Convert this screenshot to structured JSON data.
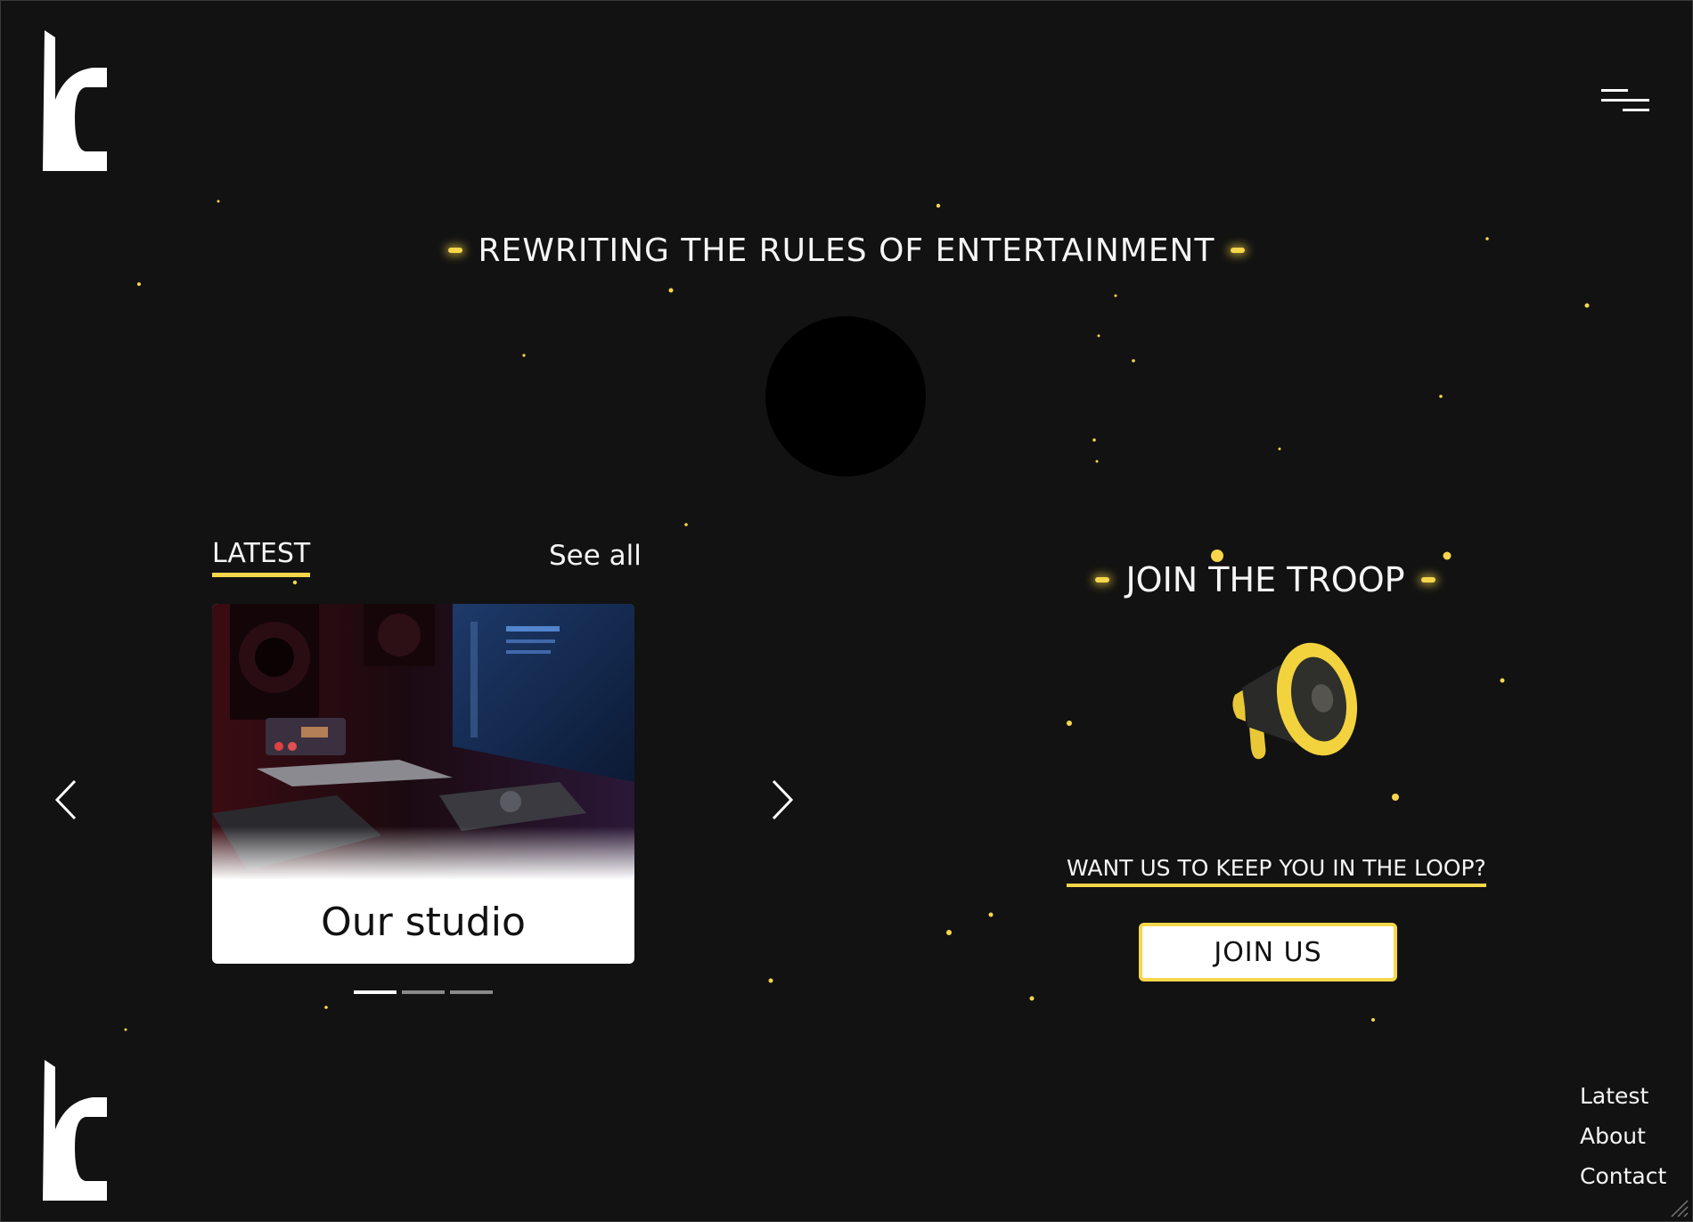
{
  "hero": {
    "title": "REWRITING THE RULES OF ENTERTAINMENT"
  },
  "latest": {
    "tab_label": "LATEST",
    "see_all_label": "See all",
    "cards": [
      {
        "title": "Our studio"
      }
    ],
    "pager": {
      "count": 3,
      "active_index": 0
    }
  },
  "troop": {
    "title": "JOIN THE TROOP",
    "prompt": "WANT US TO KEEP YOU IN THE LOOP?",
    "button_label": "JOIN US"
  },
  "footer": {
    "nav": [
      "Latest",
      "About",
      "Contact"
    ]
  },
  "icons": {
    "logo": "brand-logo-icon",
    "menu": "hamburger-menu-icon",
    "prev": "chevron-left-icon",
    "next": "chevron-right-icon",
    "megaphone": "megaphone-icon"
  },
  "colors": {
    "background": "#121212",
    "accent": "#f6d64a",
    "text": "#f5f5f5",
    "card": "#ffffff"
  }
}
